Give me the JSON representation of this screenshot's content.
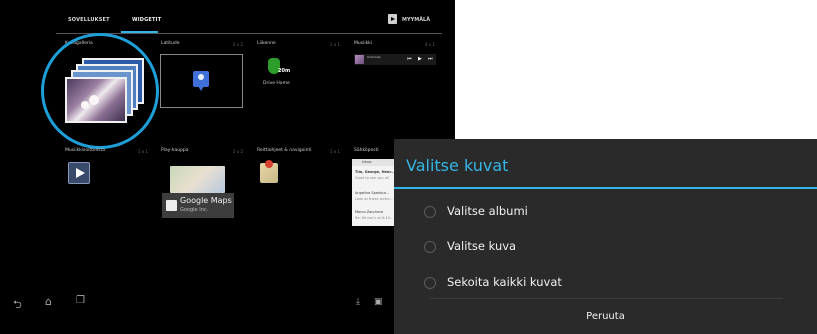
{
  "launcher": {
    "tabs": {
      "apps": "SOVELLUKSET",
      "widgets": "WIDGETIT"
    },
    "store_label": "MYYMÄLÄ",
    "widgets": [
      {
        "label": "Kuvagalleria",
        "size": ""
      },
      {
        "label": "Latitude",
        "size": "2 x 2"
      },
      {
        "label": "Liikenne",
        "size": "1 x 1"
      },
      {
        "label": "Musiikki",
        "size": "4 x 1"
      },
      {
        "label": "Musiikkisoittolista",
        "size": "1 x 1"
      },
      {
        "label": "Play-kauppa",
        "size": "2 x 2"
      },
      {
        "label": "Reittiohjeet & navigointi",
        "size": "1 x 1"
      },
      {
        "label": "Sähköposti",
        "size": ""
      }
    ],
    "traffic": {
      "badge": "20m",
      "caption": "Drive Home"
    },
    "music": {
      "title": "Unknown",
      "controls": [
        "⏮",
        "▶",
        "⏭"
      ]
    },
    "maps_card": {
      "title": "Google Maps",
      "subtitle": "Google Inc."
    },
    "email": {
      "header": "Inbox",
      "lines": [
        "Tim, George, Henr...",
        "Good to see you all",
        "Angelina Spenbur...",
        "Look at these pictur...",
        "Marco Zacchera",
        "Re: Dinner's at 6:40..."
      ]
    }
  },
  "dialog": {
    "title": "Valitse kuvat",
    "options": [
      {
        "label": "Valitse albumi",
        "selected": false
      },
      {
        "label": "Valitse kuva",
        "selected": false
      },
      {
        "label": "Sekoita kaikki kuvat",
        "selected": false
      }
    ],
    "cancel_label": "Peruuta"
  },
  "colors": {
    "accent": "#33b5e5",
    "highlight_circle": "#1e9fd8",
    "dialog_bg": "#2a2a2a"
  }
}
